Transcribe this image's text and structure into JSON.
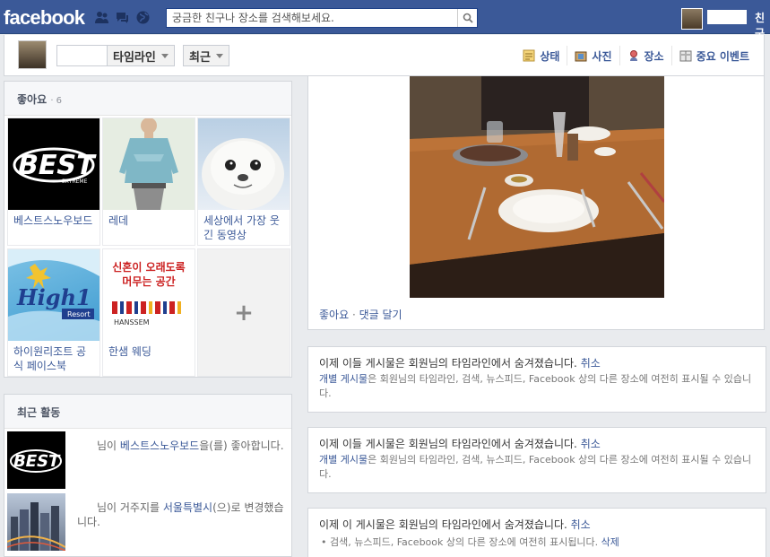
{
  "topbar": {
    "logo": "facebook",
    "search_placeholder": "궁금한 친구나 장소를 검색해보세요.",
    "friends_link": "친구",
    "colors": {
      "bar": "#3b5998",
      "link": "#3b5998"
    },
    "icons": [
      "friend-requests-icon",
      "messages-icon",
      "notifications-globe-icon",
      "search-icon"
    ]
  },
  "timeline_bar": {
    "timeline_label": "타임라인",
    "recent_label": "최근",
    "actions": [
      {
        "label": "상태",
        "icon": "status-icon"
      },
      {
        "label": "사진",
        "icon": "photo-icon"
      },
      {
        "label": "장소",
        "icon": "place-icon"
      },
      {
        "label": "중요 이벤트",
        "icon": "life-event-icon"
      }
    ]
  },
  "likes": {
    "title": "좋아요",
    "count": "· 6",
    "items": [
      {
        "label": "베스트스노우보드",
        "logo_text": "BEST",
        "logo_sub": "EXTREME"
      },
      {
        "label": "레데"
      },
      {
        "label": "세상에서 가장 웃긴 동영상"
      },
      {
        "label": "하이원리조트 공식 페이스북",
        "logo_text": "High1",
        "logo_sub": "Resort"
      },
      {
        "label": "한샘 웨딩",
        "logo_text_1": "신혼이 오래도록",
        "logo_text_2": "머무는 공간",
        "logo_sub": "HANSSEM"
      }
    ],
    "add_label": "+"
  },
  "recent": {
    "title": "최근 활동",
    "items": [
      {
        "pre": "님이 ",
        "link": "베스트스노우보드",
        "post": "을(를) 좋아합니다."
      },
      {
        "pre": "님이 거주지를 ",
        "link": "서울특별시",
        "post": "(으)로 변경했습니다."
      }
    ]
  },
  "photo_post": {
    "like": "좋아요",
    "sep": " · ",
    "comment": "댓글 달기"
  },
  "notices": [
    {
      "text": "이제 이들 게시물은 회원님의 타임라인에서 숨겨졌습니다.",
      "undo": "취소",
      "detail_link": "개별 게시물",
      "detail": "은 회원님의 타임라인, 검색, 뉴스피드, Facebook 상의 다른 장소에 여전히 표시될 수 있습니다."
    },
    {
      "text": "이제 이들 게시물은 회원님의 타임라인에서 숨겨졌습니다.",
      "undo": "취소",
      "detail_link": "개별 게시물",
      "detail": "은 회원님의 타임라인, 검색, 뉴스피드, Facebook 상의 다른 장소에 여전히 표시될 수 있습니다."
    },
    {
      "text": "이제 이 게시물은 회원님의 타임라인에서 숨겨졌습니다.",
      "undo": "취소",
      "bullet": "검색, 뉴스피드, Facebook 상의 다른 장소에 여전히 표시됩니다.",
      "delete": "삭제"
    }
  ]
}
